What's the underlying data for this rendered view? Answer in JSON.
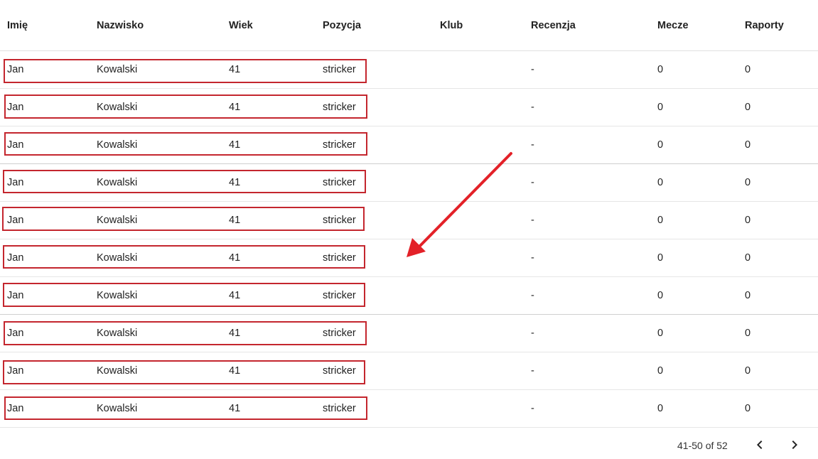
{
  "table": {
    "headers": {
      "imie": "Imię",
      "nazwisko": "Nazwisko",
      "wiek": "Wiek",
      "pozycja": "Pozycja",
      "klub": "Klub",
      "recenzja": "Recenzja",
      "mecze": "Mecze",
      "raporty": "Raporty"
    },
    "rows": [
      {
        "imie": "Jan",
        "nazwisko": "Kowalski",
        "wiek": "41",
        "pozycja": "stricker",
        "klub": "",
        "recenzja": "-",
        "mecze": "0",
        "raporty": "0"
      },
      {
        "imie": "Jan",
        "nazwisko": "Kowalski",
        "wiek": "41",
        "pozycja": "stricker",
        "klub": "",
        "recenzja": "-",
        "mecze": "0",
        "raporty": "0"
      },
      {
        "imie": "Jan",
        "nazwisko": "Kowalski",
        "wiek": "41",
        "pozycja": "stricker",
        "klub": "",
        "recenzja": "-",
        "mecze": "0",
        "raporty": "0"
      },
      {
        "imie": "Jan",
        "nazwisko": "Kowalski",
        "wiek": "41",
        "pozycja": "stricker",
        "klub": "",
        "recenzja": "-",
        "mecze": "0",
        "raporty": "0"
      },
      {
        "imie": "Jan",
        "nazwisko": "Kowalski",
        "wiek": "41",
        "pozycja": "stricker",
        "klub": "",
        "recenzja": "-",
        "mecze": "0",
        "raporty": "0"
      },
      {
        "imie": "Jan",
        "nazwisko": "Kowalski",
        "wiek": "41",
        "pozycja": "stricker",
        "klub": "",
        "recenzja": "-",
        "mecze": "0",
        "raporty": "0"
      },
      {
        "imie": "Jan",
        "nazwisko": "Kowalski",
        "wiek": "41",
        "pozycja": "stricker",
        "klub": "",
        "recenzja": "-",
        "mecze": "0",
        "raporty": "0"
      },
      {
        "imie": "Jan",
        "nazwisko": "Kowalski",
        "wiek": "41",
        "pozycja": "stricker",
        "klub": "",
        "recenzja": "-",
        "mecze": "0",
        "raporty": "0"
      },
      {
        "imie": "Jan",
        "nazwisko": "Kowalski",
        "wiek": "41",
        "pozycja": "stricker",
        "klub": "",
        "recenzja": "-",
        "mecze": "0",
        "raporty": "0"
      },
      {
        "imie": "Jan",
        "nazwisko": "Kowalski",
        "wiek": "41",
        "pozycja": "stricker",
        "klub": "",
        "recenzja": "-",
        "mecze": "0",
        "raporty": "0"
      }
    ]
  },
  "pagination": {
    "range_label": "41-50 of 52",
    "prev_icon": "chevron-left-icon",
    "next_icon": "chevron-right-icon"
  },
  "annotations": {
    "highlight_color": "#c4262e",
    "arrow_color": "#e32128"
  }
}
